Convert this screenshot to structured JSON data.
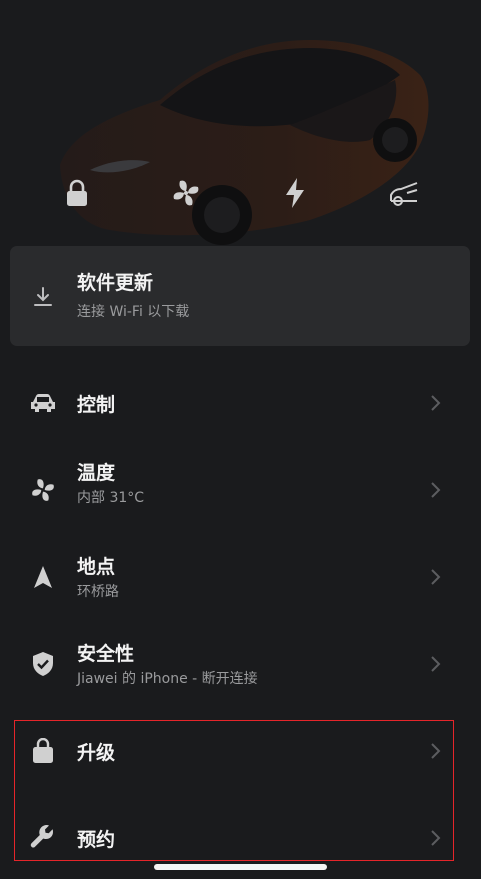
{
  "update": {
    "title": "软件更新",
    "subtitle": "连接 Wi-Fi 以下载",
    "icon": "download-icon"
  },
  "quick_actions": [
    {
      "icon": "lock-icon"
    },
    {
      "icon": "fan-icon"
    },
    {
      "icon": "lightning-icon"
    },
    {
      "icon": "frunk-icon"
    }
  ],
  "menu": [
    {
      "title": "控制",
      "subtitle": "",
      "icon": "car-icon"
    },
    {
      "title": "温度",
      "subtitle": "内部 31°C",
      "icon": "fan-icon"
    },
    {
      "title": "地点",
      "subtitle": "环桥路",
      "icon": "location-arrow-icon"
    },
    {
      "title": "安全性",
      "subtitle": "Jiawei 的 iPhone - 断开连接",
      "icon": "shield-check-icon"
    },
    {
      "title": "升级",
      "subtitle": "",
      "icon": "shopping-bag-icon"
    },
    {
      "title": "预约",
      "subtitle": "",
      "icon": "wrench-icon"
    }
  ],
  "colors": {
    "background": "#1a1b1d",
    "card": "#2a2b2d",
    "text_primary": "#f3f3f3",
    "text_secondary": "#9a9b9d",
    "chevron": "#5c5d60",
    "highlight": "#e5252a"
  }
}
